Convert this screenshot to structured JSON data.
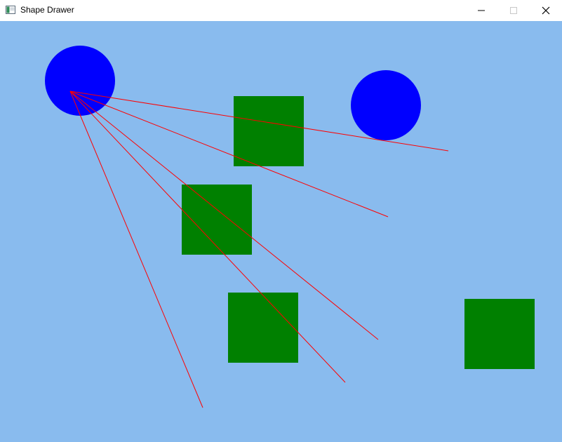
{
  "window": {
    "title": "Shape Drawer",
    "icon": "app-window-icon",
    "controls": [
      "minimize-icon",
      "maximize-icon",
      "close-icon"
    ]
  },
  "canvas": {
    "background": "#89bbee",
    "circle_color": "#0000ff",
    "square_color": "#008000",
    "line_color": "#ff0000"
  }
}
